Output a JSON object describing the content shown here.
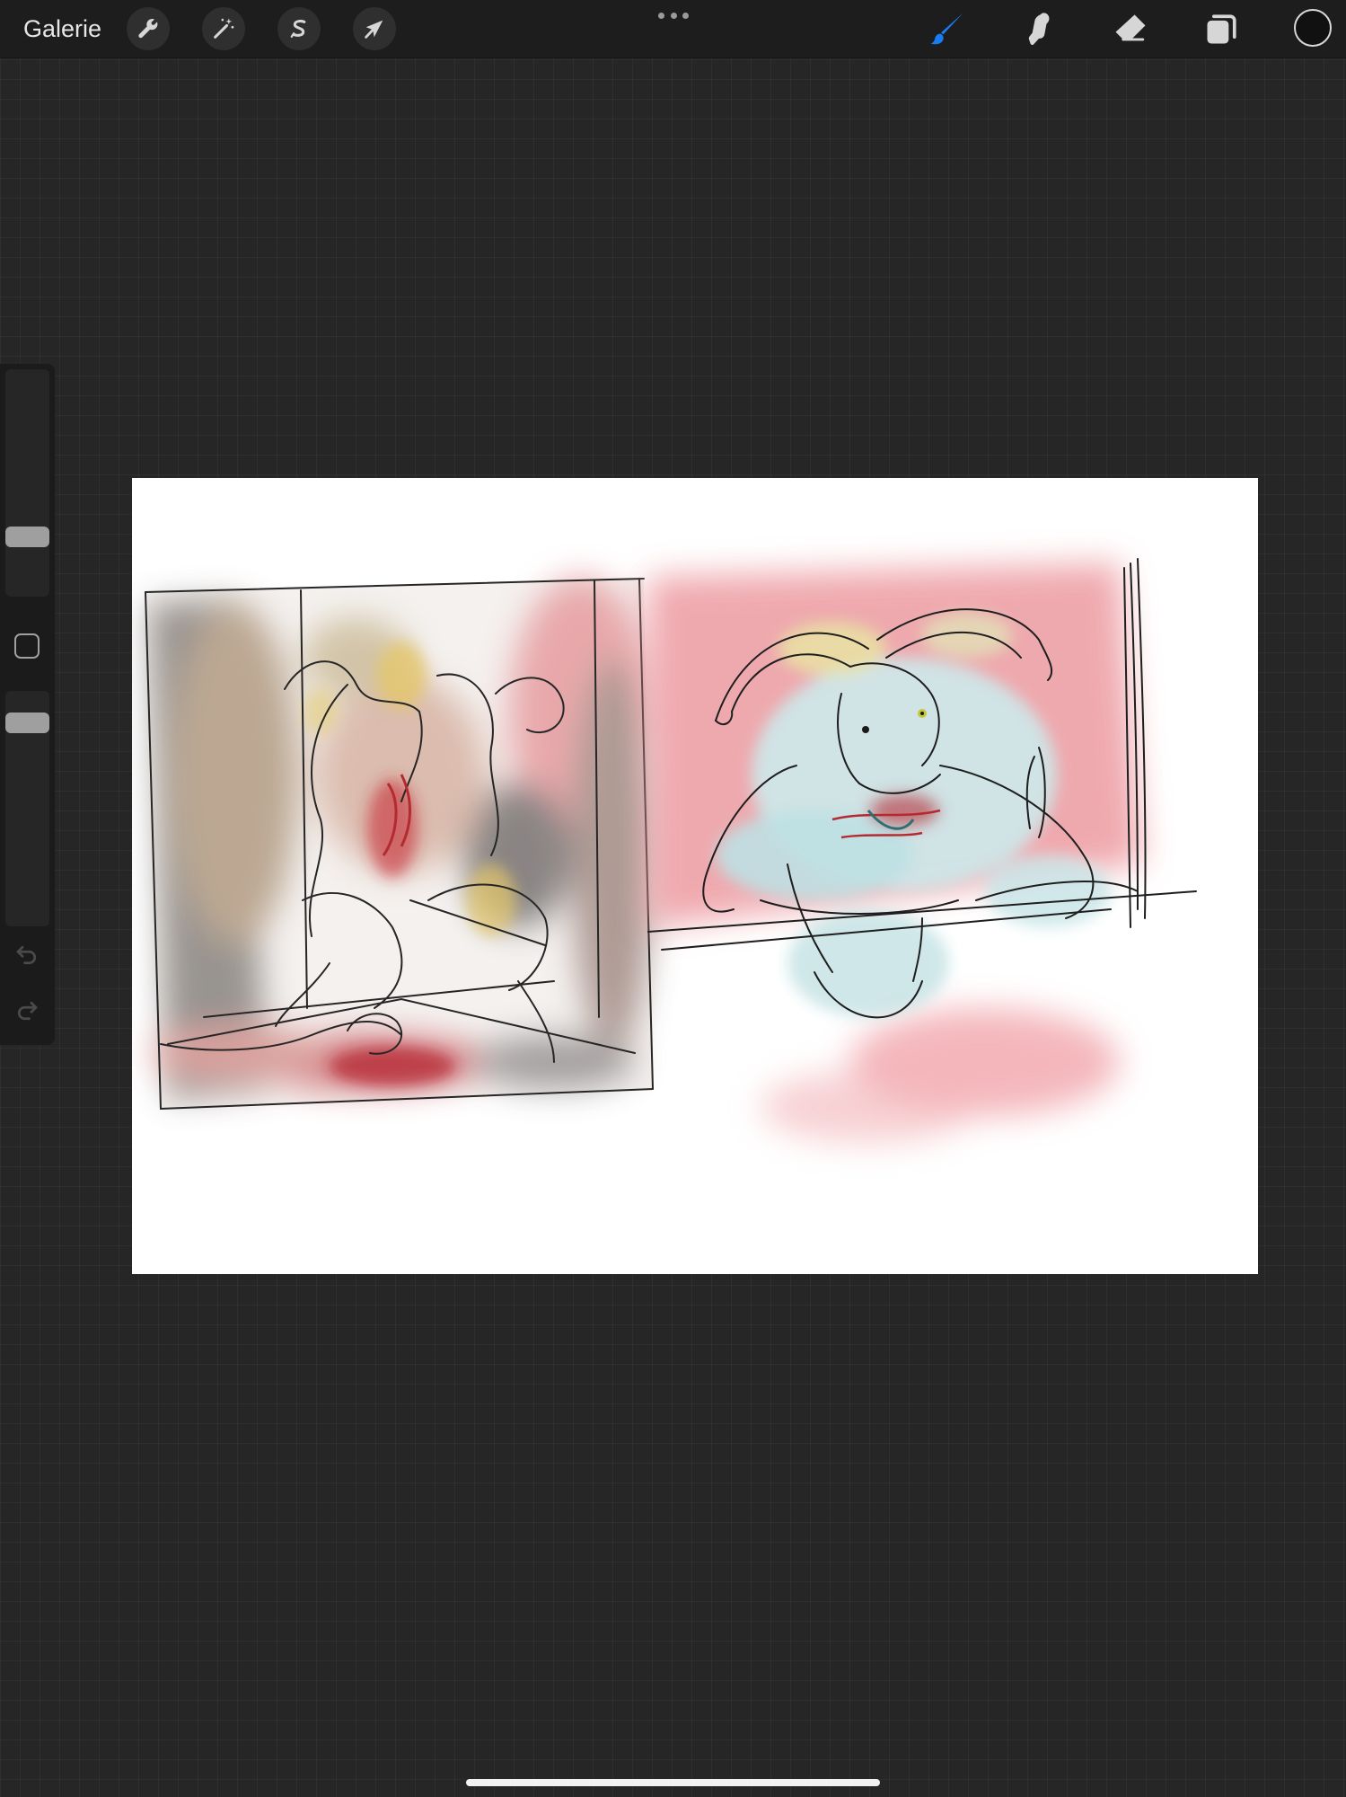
{
  "toolbar": {
    "gallery_label": "Galerie",
    "left_tools": [
      {
        "icon": "wrench-icon",
        "name": "actions-button"
      },
      {
        "icon": "magic-wand-icon",
        "name": "adjustments-button"
      },
      {
        "icon": "selection-s-icon",
        "name": "selection-button"
      },
      {
        "icon": "arrow-cursor-icon",
        "name": "transform-button"
      }
    ],
    "right_tools": [
      {
        "icon": "brush-icon",
        "name": "paint-tool-button",
        "active": true,
        "color": "#1a7cf5"
      },
      {
        "icon": "smudge-icon",
        "name": "smudge-tool-button",
        "active": false
      },
      {
        "icon": "eraser-icon",
        "name": "eraser-tool-button",
        "active": false
      },
      {
        "icon": "layers-icon",
        "name": "layers-button",
        "active": false
      }
    ],
    "current_color": "#111111"
  },
  "sidebar": {
    "brush_size_level": 0.24,
    "opacity_level": 0.9,
    "undo_icon": "undo-icon",
    "redo_icon": "redo-icon",
    "modify_icon": "square-modify-icon"
  },
  "canvas": {
    "background": "#ffffff"
  }
}
